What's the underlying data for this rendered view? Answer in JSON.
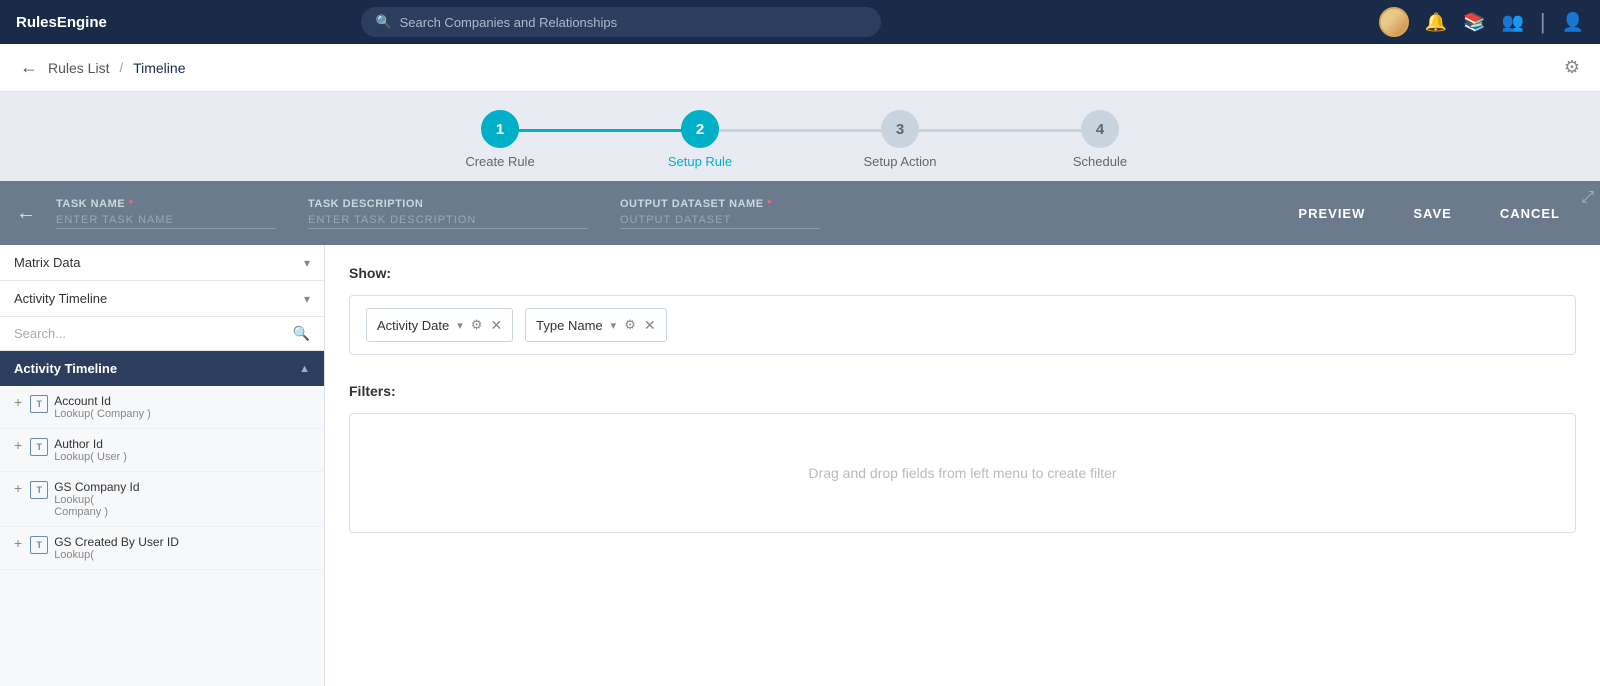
{
  "app": {
    "title": "RulesEngine"
  },
  "topnav": {
    "search_placeholder": "Search Companies and Relationships",
    "bell_icon": "🔔",
    "book_icon": "📖",
    "person_icon": "👤",
    "user_icon": "👤"
  },
  "breadcrumb": {
    "back_label": "←",
    "rules_list": "Rules List",
    "separator": "/",
    "current": "Timeline",
    "gear_icon": "⚙"
  },
  "steps": [
    {
      "number": "1",
      "label": "Create Rule",
      "state": "completed"
    },
    {
      "number": "2",
      "label": "Setup Rule",
      "state": "active"
    },
    {
      "number": "3",
      "label": "Setup Action",
      "state": "inactive"
    },
    {
      "number": "4",
      "label": "Schedule",
      "state": "inactive"
    }
  ],
  "taskbar": {
    "back_icon": "←",
    "task_name_label": "Task Name",
    "task_name_req": "*",
    "task_name_placeholder": "ENTER TASK NAME",
    "task_desc_label": "Task Description",
    "task_desc_placeholder": "ENTER TASK DESCRIPTION",
    "output_label": "Output Dataset Name",
    "output_req": "*",
    "output_placeholder": "OUTPUT DATASET",
    "preview_btn": "PREVIEW",
    "save_btn": "SAVE",
    "cancel_btn": "CANCEL"
  },
  "leftpanel": {
    "dropdown1_label": "Matrix Data",
    "dropdown2_label": "Activity Timeline",
    "search_placeholder": "Search...",
    "search_icon": "🔍",
    "section_header": "Activity Timeline",
    "fields": [
      {
        "name": "Account Id",
        "lookup": "Lookup( Company )"
      },
      {
        "name": "Author Id",
        "lookup": "Lookup( User )"
      },
      {
        "name": "GS Company Id",
        "lookup": "Lookup( Company )"
      },
      {
        "name": "GS Created By User ID",
        "lookup": "Lookup("
      }
    ]
  },
  "rightpanel": {
    "show_label": "Show:",
    "filters_label": "Filters:",
    "filters_placeholder": "Drag and drop fields from left menu to create filter",
    "show_fields": [
      {
        "label": "Activity Date"
      },
      {
        "label": "Type Name"
      }
    ]
  }
}
